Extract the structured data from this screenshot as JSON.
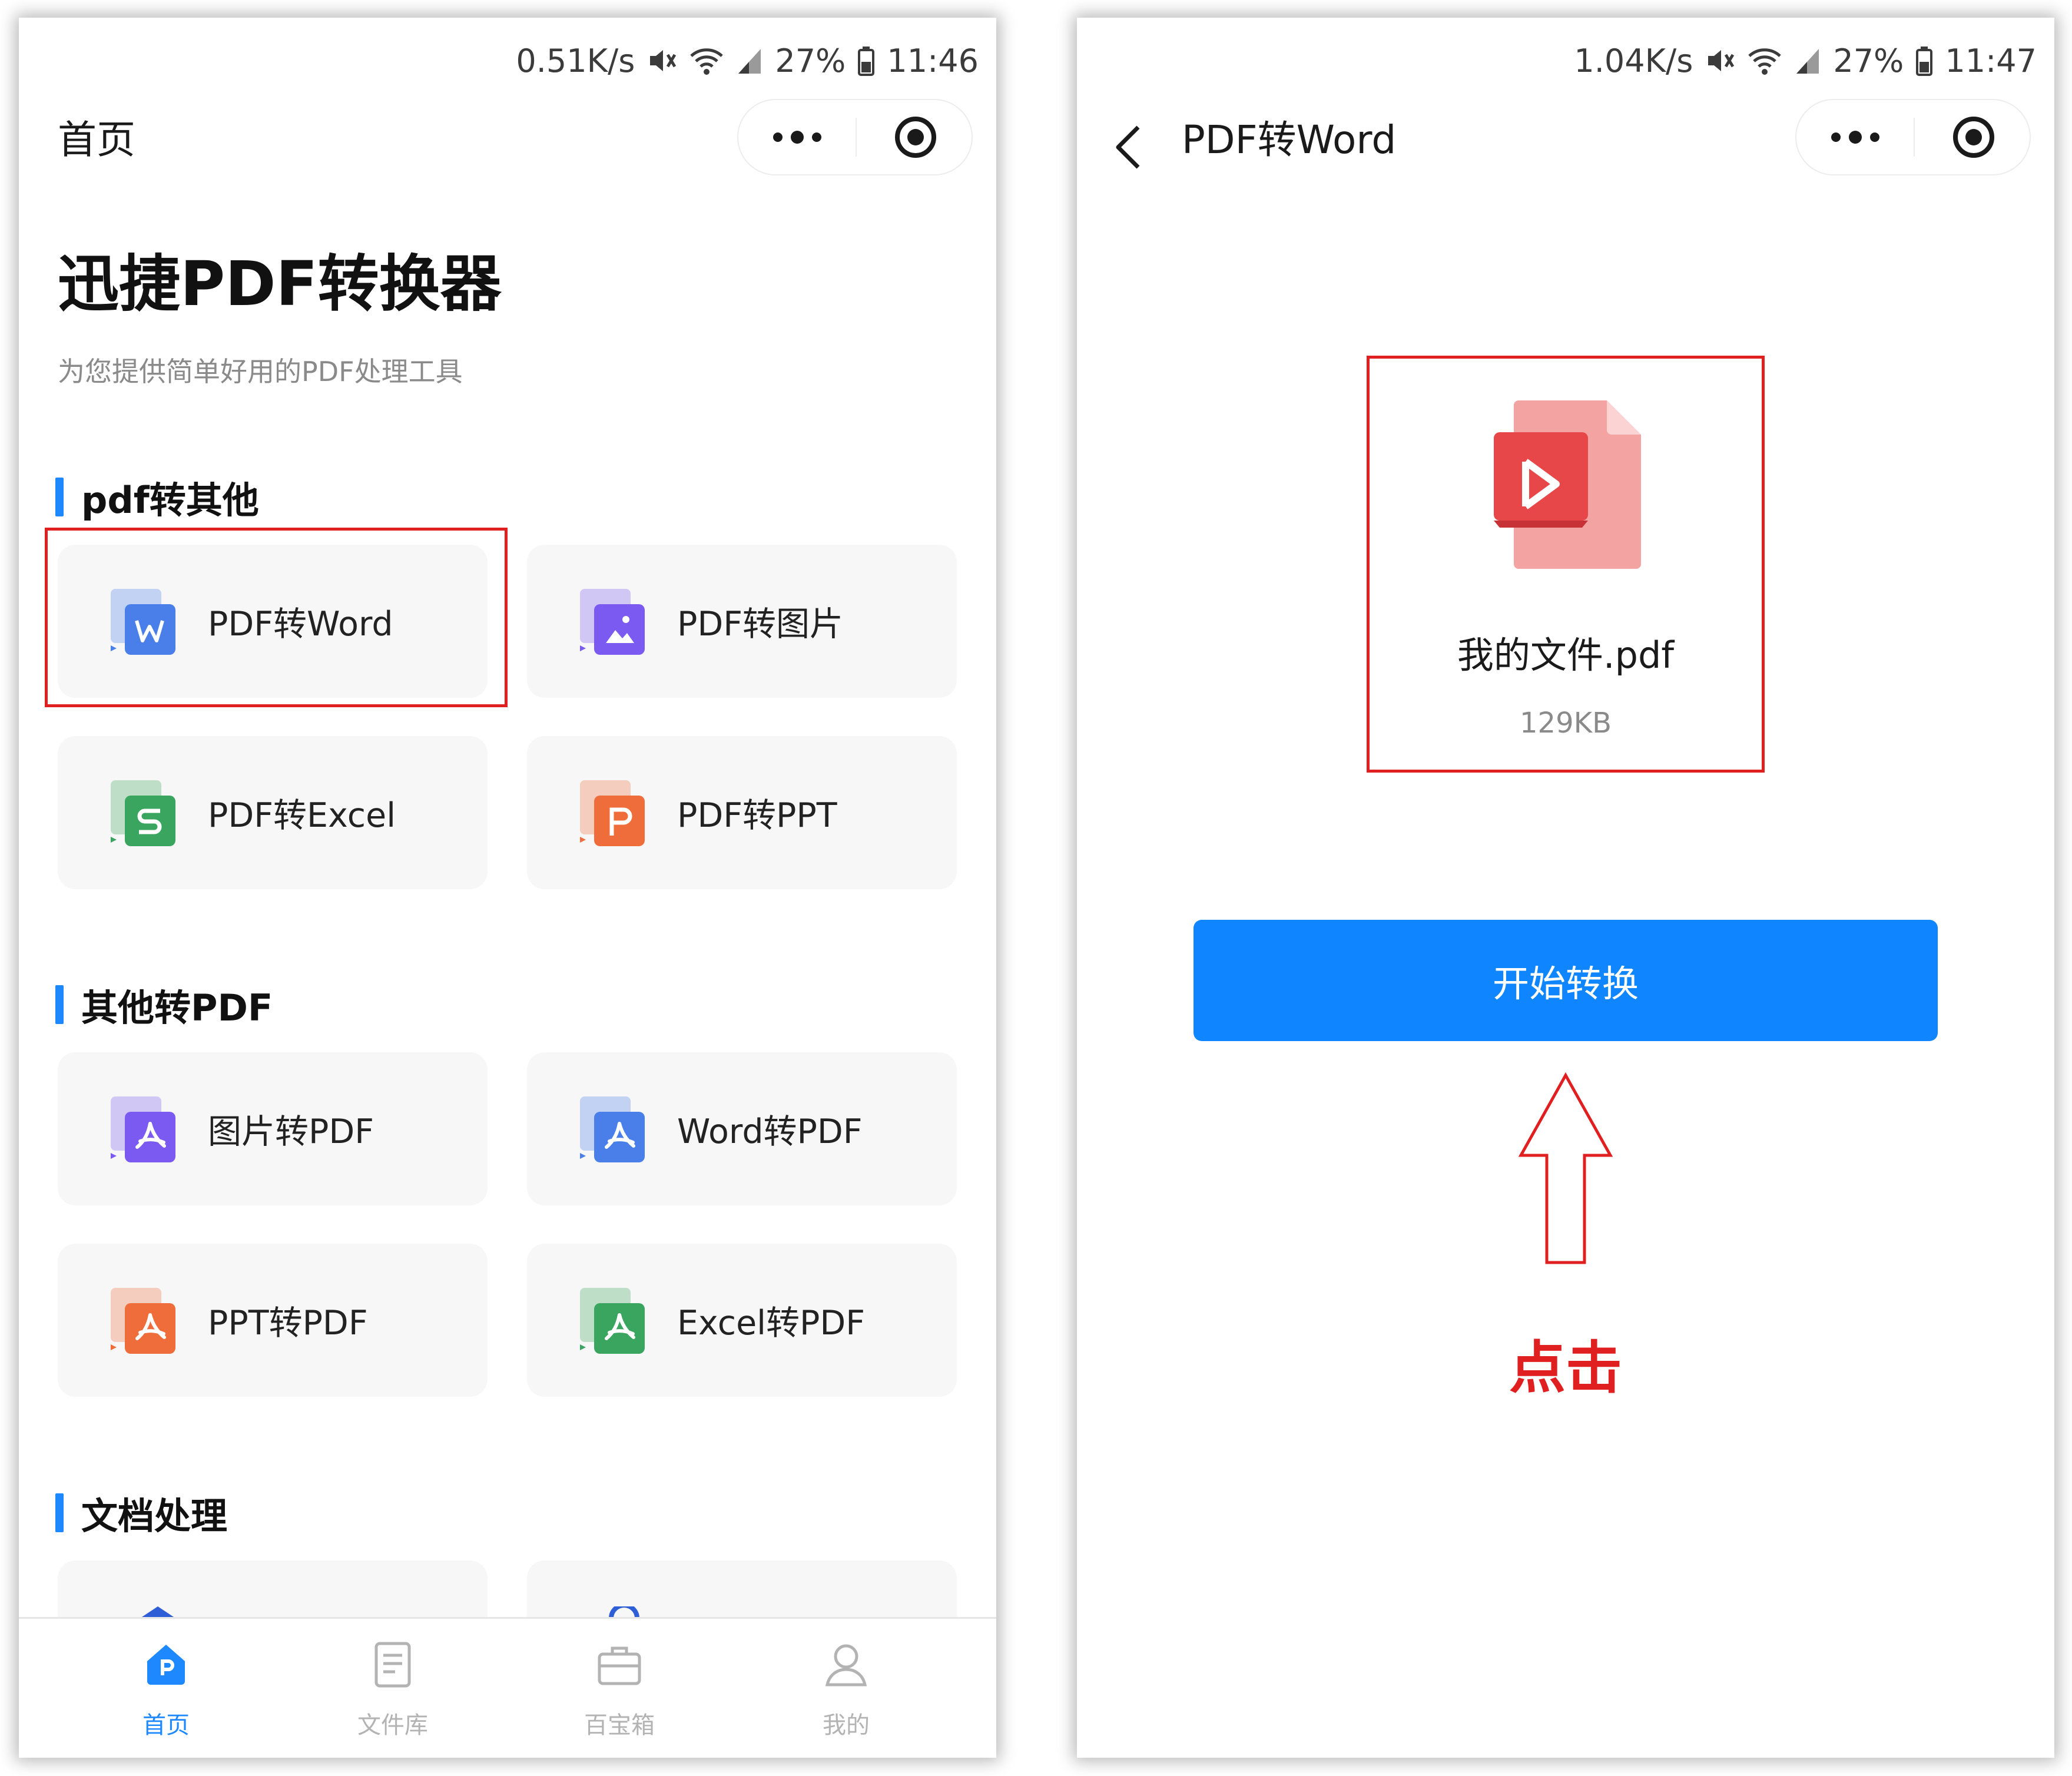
{
  "left": {
    "status": {
      "speed": "0.51K/s",
      "battery": "27%",
      "time": "11:46"
    },
    "nav_title": "首页",
    "title": "迅捷PDF转换器",
    "subtitle": "为您提供简单好用的PDF处理工具",
    "sections": [
      {
        "title": "pdf转其他",
        "items": [
          {
            "label": "PDF转Word",
            "icon": "word-icon",
            "color": "#4a7fea"
          },
          {
            "label": "PDF转图片",
            "icon": "image-icon",
            "color": "#7a5af0"
          },
          {
            "label": "PDF转Excel",
            "icon": "excel-icon",
            "color": "#3aa55e"
          },
          {
            "label": "PDF转PPT",
            "icon": "ppt-icon",
            "color": "#ef6d3a"
          }
        ]
      },
      {
        "title": "其他转PDF",
        "items": [
          {
            "label": "图片转PDF",
            "icon": "pdf-icon",
            "color": "#7a5af0"
          },
          {
            "label": "Word转PDF",
            "icon": "pdf-icon",
            "color": "#4a7fea"
          },
          {
            "label": "PPT转PDF",
            "icon": "pdf-icon",
            "color": "#ef6d3a"
          },
          {
            "label": "Excel转PDF",
            "icon": "pdf-icon",
            "color": "#3aa55e"
          }
        ]
      },
      {
        "title": "文档处理",
        "items": []
      }
    ],
    "tabbar": [
      {
        "label": "首页",
        "icon": "home-icon",
        "active": true
      },
      {
        "label": "文件库",
        "icon": "document-icon",
        "active": false
      },
      {
        "label": "百宝箱",
        "icon": "toolbox-icon",
        "active": false
      },
      {
        "label": "我的",
        "icon": "user-icon",
        "active": false
      }
    ]
  },
  "right": {
    "status": {
      "speed": "1.04K/s",
      "battery": "27%",
      "time": "11:47"
    },
    "nav_title": "PDF转Word",
    "file_name": "我的文件.pdf",
    "file_size": "129KB",
    "start_button": "开始转换",
    "hint": "点击"
  },
  "colors": {
    "accent": "#1e88ff",
    "button": "#0f86ff",
    "highlight": "#e02020",
    "tile_bg": "#f7f7f7"
  }
}
